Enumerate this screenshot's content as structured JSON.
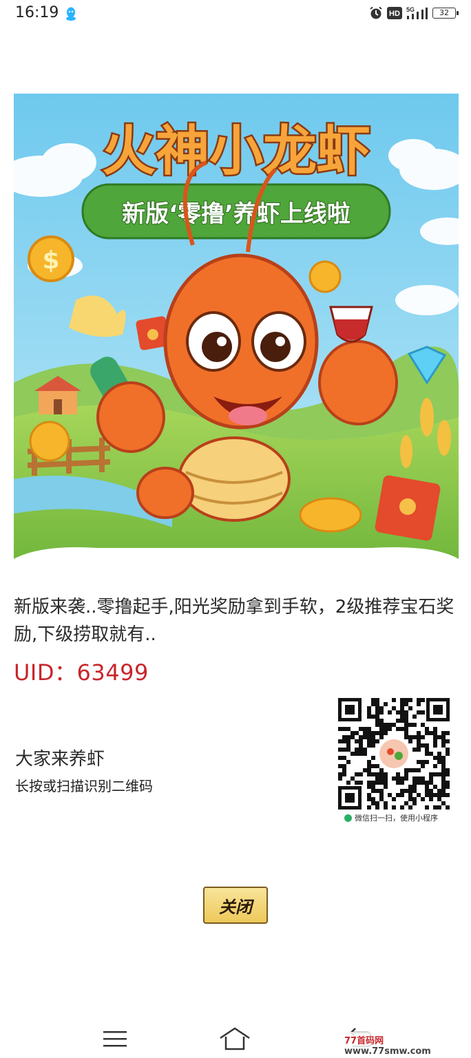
{
  "status_bar": {
    "time": "16:19",
    "network": "5G",
    "hd_label": "HD",
    "battery": "32",
    "icons": [
      "qq-icon",
      "alarm-icon",
      "hd-icon",
      "signal-icon",
      "battery-icon"
    ]
  },
  "poster": {
    "title": "火神小龙虾",
    "subtitle": "新版‘零撸’养虾上线啦"
  },
  "description": "新版来袭..零撸起手,阳光奖励拿到手软，2级推荐宝石奖励,下级捞取就有..",
  "uid": {
    "label": "UID：",
    "value": "63499"
  },
  "mini_program": {
    "name": "大家来养虾",
    "scan_hint": "长按或扫描识别二维码",
    "qr_caption": "微信扫一扫，使用小程序"
  },
  "close_button": "关闭",
  "watermark": {
    "prefix": "77首码网",
    "domain": "www.77smw.com"
  },
  "colors": {
    "uid": "#c7262b",
    "button_fill": "#f1d27a",
    "sky": "#7fd3f0",
    "grass": "#8cc84b"
  }
}
